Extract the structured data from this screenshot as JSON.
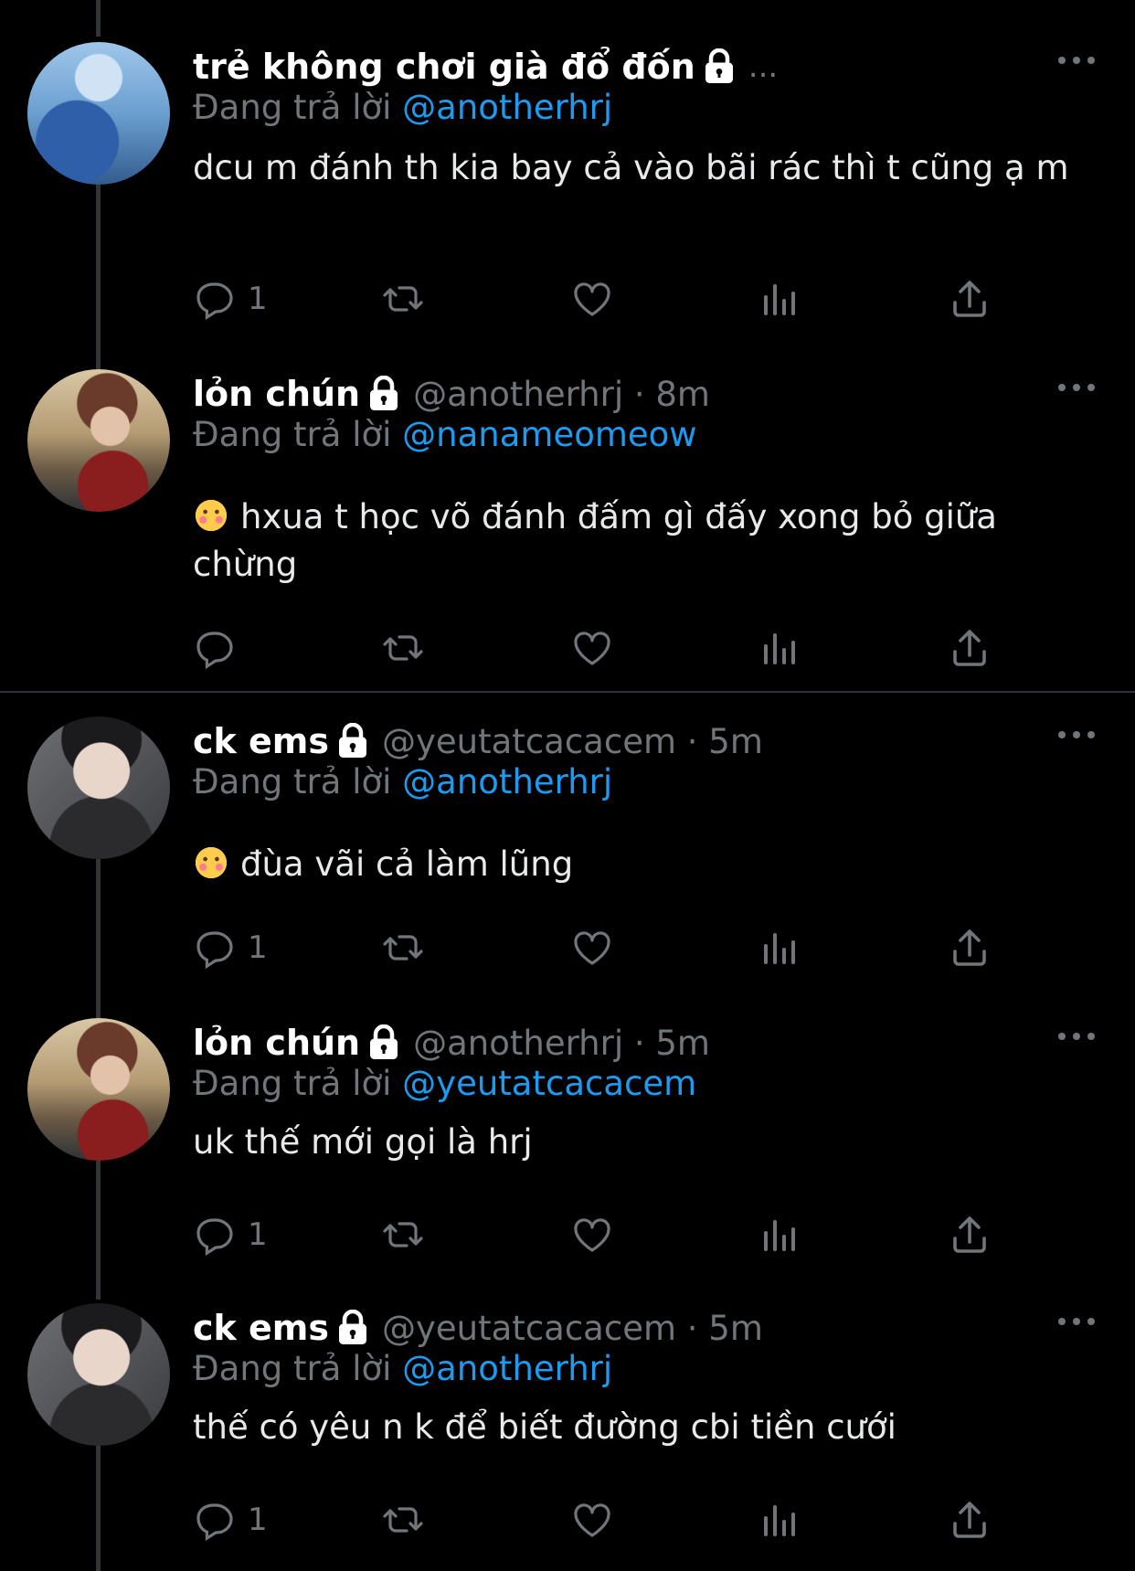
{
  "tweets": [
    {
      "name": "trẻ không chơi già đổ đốn",
      "handle": "",
      "time": "",
      "suffix": "...",
      "reply_prefix": "Đang trả lời",
      "reply_to": "@anotherhrj",
      "text": "dcu m đánh th kia bay cả vào bãi rác thì t cũng ạ m",
      "emoji": "",
      "reply_count": "1"
    },
    {
      "name": "lỏn chún",
      "handle": "@anotherhrj · 8m",
      "reply_prefix": "Đang trả lời",
      "reply_to": "@nanameomeow",
      "text": "hxua t học võ đánh đấm gì đấy xong bỏ giữa chừng",
      "emoji": "smiling-face-with-hearts",
      "reply_count": ""
    },
    {
      "name": "ck ems",
      "handle": "@yeutatcacacem · 5m",
      "reply_prefix": "Đang trả lời",
      "reply_to": "@anotherhrj",
      "text": "đùa vãi cả làm lũng",
      "emoji": "smiling-face-with-hearts",
      "reply_count": "1"
    },
    {
      "name": "lỏn chún",
      "handle": "@anotherhrj · 5m",
      "reply_prefix": "Đang trả lời",
      "reply_to": "@yeutatcacacem",
      "text": "uk thế mới gọi là hrj",
      "emoji": "",
      "reply_count": "1"
    },
    {
      "name": "ck ems",
      "handle": "@yeutatcacacem · 5m",
      "reply_prefix": "Đang trả lời",
      "reply_to": "@anotherhrj",
      "text": "thế có yêu n k để biết đường cbi tiền cưới",
      "emoji": "",
      "reply_count": "1"
    }
  ],
  "colors": {
    "background": "#000000",
    "text": "#e7e9ea",
    "secondary": "#71767b",
    "mention": "#1d9bf0"
  },
  "icons": [
    "lock-icon",
    "more-icon",
    "reply-icon",
    "retweet-icon",
    "like-icon",
    "views-icon",
    "share-icon",
    "emoji-icon"
  ]
}
